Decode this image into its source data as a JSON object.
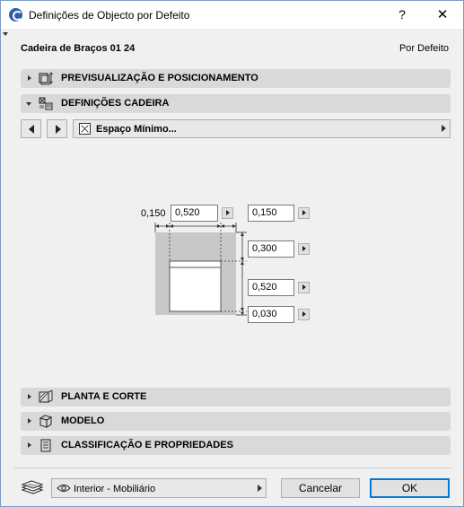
{
  "window": {
    "title": "Definições de Objecto por Defeito",
    "help_label": "?",
    "close_label": "✕"
  },
  "header": {
    "object_name": "Cadeira de Braços 01 24",
    "default_label": "Por Defeito"
  },
  "panels": {
    "preview": {
      "label": "PREVISUALIZAÇÃO E POSICIONAMENTO",
      "icon": "preview-positioning-icon",
      "expanded": false
    },
    "settings": {
      "label": "DEFINIÇÕES CADEIRA",
      "icon": "chair-settings-icon",
      "expanded": true
    },
    "plan": {
      "label": "PLANTA E CORTE",
      "icon": "plan-section-icon",
      "expanded": false
    },
    "model": {
      "label": "MODELO",
      "icon": "model-cube-icon",
      "expanded": false
    },
    "classification": {
      "label": "CLASSIFICAÇÃO E PROPRIEDADES",
      "icon": "classification-icon",
      "expanded": false
    }
  },
  "page_selector": {
    "label": "Espaço Mínimo..."
  },
  "dimensions": {
    "left_clearance_label": "0,150",
    "width_value": "0,520",
    "right_clearance_value": "0,150",
    "front_clearance_value": "0,300",
    "depth_value": "0,520",
    "back_clearance_value": "0,030"
  },
  "footer": {
    "layer_value": "Interior - Mobiliário",
    "cancel_label": "Cancelar",
    "ok_label": "OK"
  },
  "colors": {
    "panel_bg": "#d9d9d9",
    "dialog_bg": "#f0f0f0",
    "ok_border": "#0078d7",
    "diagram_clearance": "#c8c8c8"
  }
}
